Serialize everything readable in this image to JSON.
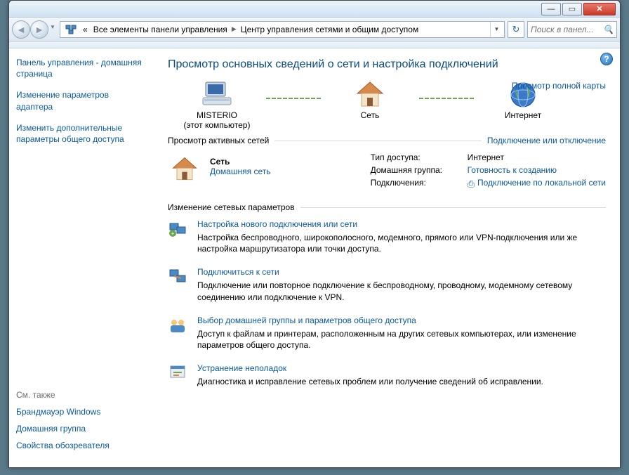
{
  "window": {
    "min": "—",
    "max": "▭",
    "close": "✕"
  },
  "nav": {
    "back_glyph": "◄",
    "fwd_glyph": "►",
    "dropdown_glyph": "▼",
    "refresh_glyph": "↻",
    "crumb_prefix": "«",
    "crumbs": [
      "Все элементы панели управления",
      "Центр управления сетями и общим доступом"
    ],
    "search_placeholder": "Поиск в панел...",
    "search_icon": "🔍"
  },
  "sidebar": {
    "links": [
      "Панель управления - домашняя страница",
      "Изменение параметров адаптера",
      "Изменить дополнительные параметры общего доступа"
    ],
    "see_also_header": "См. также",
    "see_also": [
      "Брандмауэр Windows",
      "Домашняя группа",
      "Свойства обозревателя"
    ]
  },
  "main": {
    "help_glyph": "?",
    "heading": "Просмотр основных сведений о сети и настройка подключений",
    "full_map_link": "Просмотр полной карты",
    "map": {
      "computer_name": "MISTERIO",
      "computer_sub": "(этот компьютер)",
      "network_label": "Сеть",
      "internet_label": "Интернет"
    },
    "active_header": "Просмотр активных сетей",
    "active_rlink": "Подключение или отключение",
    "active_net": {
      "name": "Сеть",
      "type_link": "Домашняя сеть",
      "props": {
        "access_k": "Тип доступа:",
        "access_v": "Интернет",
        "homegroup_k": "Домашняя группа:",
        "homegroup_v": "Готовность к созданию",
        "conn_k": "Подключения:",
        "conn_v": "Подключение по локальной сети"
      }
    },
    "change_header": "Изменение сетевых параметров",
    "tasks": [
      {
        "title": "Настройка нового подключения или сети",
        "desc": "Настройка беспроводного, широкополосного, модемного, прямого или VPN-подключения или же настройка маршрутизатора или точки доступа."
      },
      {
        "title": "Подключиться к сети",
        "desc": "Подключение или повторное подключение к беспроводному, проводному, модемному сетевому соединению или подключение к VPN."
      },
      {
        "title": "Выбор домашней группы и параметров общего доступа",
        "desc": "Доступ к файлам и принтерам, расположенным на других сетевых компьютерах, или изменение параметров общего доступа."
      },
      {
        "title": "Устранение неполадок",
        "desc": "Диагностика и исправление сетевых проблем или получение сведений об исправлении."
      }
    ]
  }
}
